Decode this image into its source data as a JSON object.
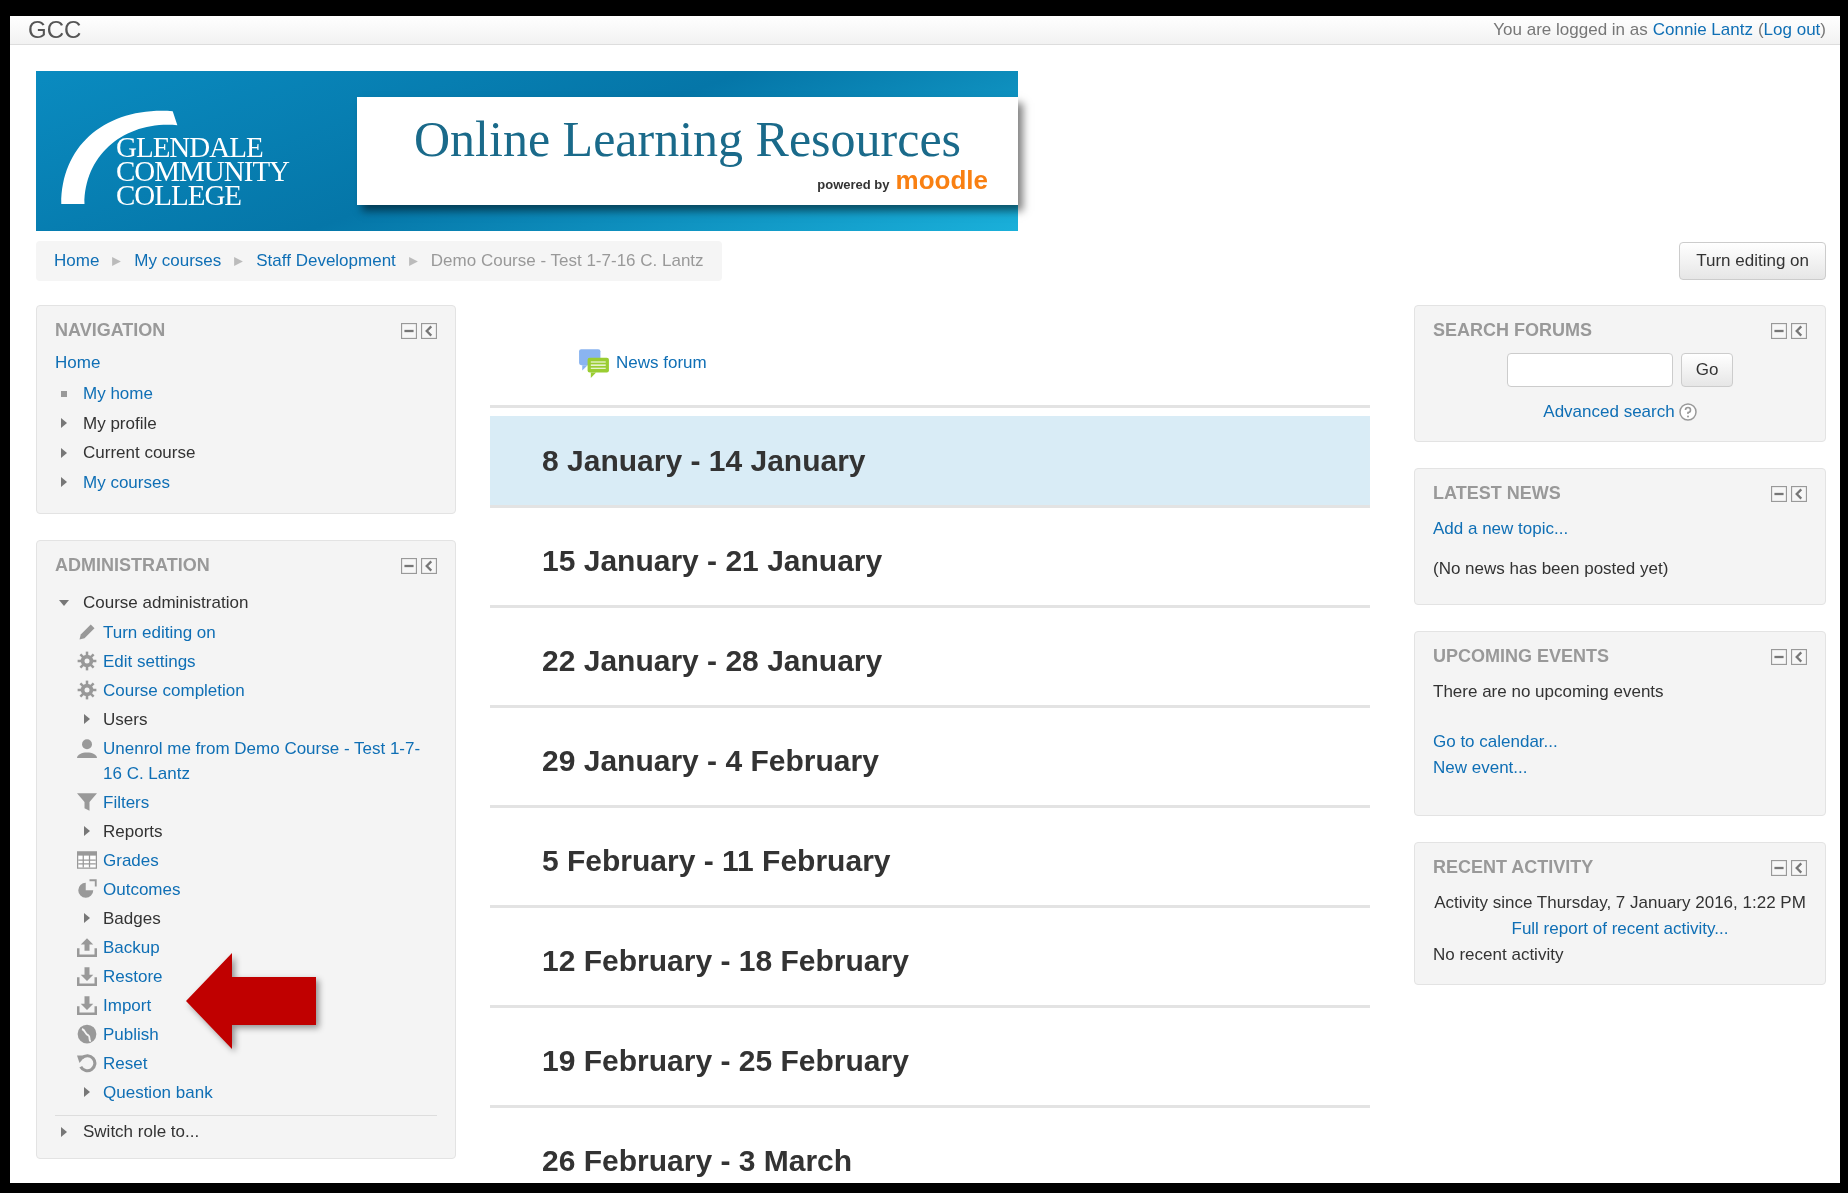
{
  "header": {
    "site_name": "GCC",
    "login_prefix": "You are logged in as",
    "user": "Connie Lantz",
    "paren_open": "(",
    "logout": "Log out",
    "paren_close": ")"
  },
  "banner": {
    "college_lines": [
      "GLENDALE",
      "COMMUNITY",
      "COLLEGE"
    ],
    "title": "Online Learning Resources",
    "powered_by": "powered by",
    "brand": "moodle"
  },
  "breadcrumb": [
    {
      "label": "Home",
      "current": false
    },
    {
      "label": "My courses",
      "current": false
    },
    {
      "label": "Staff Development",
      "current": false
    },
    {
      "label": "Demo Course - Test 1-7-16 C. Lantz",
      "current": true
    }
  ],
  "edit_button": "Turn editing on",
  "navigation": {
    "title": "NAVIGATION",
    "root": "Home",
    "items": [
      {
        "label": "My home",
        "kind": "bullet",
        "link": true
      },
      {
        "label": "My profile",
        "kind": "branch",
        "link": false
      },
      {
        "label": "Current course",
        "kind": "branch",
        "link": false
      },
      {
        "label": "My courses",
        "kind": "branch",
        "link": true
      }
    ]
  },
  "administration": {
    "title": "ADMINISTRATION",
    "section": {
      "label": "Course administration",
      "expanded": true,
      "children": [
        {
          "label": "Turn editing on",
          "kind": "pencil",
          "link": true
        },
        {
          "label": "Edit settings",
          "kind": "gear",
          "link": true
        },
        {
          "label": "Course completion",
          "kind": "gear",
          "link": true
        },
        {
          "label": "Users",
          "kind": "branch",
          "link": false
        },
        {
          "label": "Unenrol me from Demo Course - Test 1-7-16 C. Lantz",
          "kind": "user",
          "link": true
        },
        {
          "label": "Filters",
          "kind": "filter",
          "link": true
        },
        {
          "label": "Reports",
          "kind": "branch",
          "link": false
        },
        {
          "label": "Grades",
          "kind": "table",
          "link": true
        },
        {
          "label": "Outcomes",
          "kind": "outcome",
          "link": true
        },
        {
          "label": "Badges",
          "kind": "branch",
          "link": false
        },
        {
          "label": "Backup",
          "kind": "upload",
          "link": true
        },
        {
          "label": "Restore",
          "kind": "download",
          "link": true
        },
        {
          "label": "Import",
          "kind": "download",
          "link": true
        },
        {
          "label": "Publish",
          "kind": "globe",
          "link": true
        },
        {
          "label": "Reset",
          "kind": "reset",
          "link": true
        },
        {
          "label": "Question bank",
          "kind": "branch",
          "link": true
        }
      ]
    },
    "after": {
      "label": "Switch role to...",
      "expanded": false
    }
  },
  "news_forum": "News forum",
  "weeks": [
    {
      "title": "8 January - 14 January",
      "current": true
    },
    {
      "title": "15 January - 21 January",
      "current": false
    },
    {
      "title": "22 January - 28 January",
      "current": false
    },
    {
      "title": "29 January - 4 February",
      "current": false
    },
    {
      "title": "5 February - 11 February",
      "current": false
    },
    {
      "title": "12 February - 18 February",
      "current": false
    },
    {
      "title": "19 February - 25 February",
      "current": false
    },
    {
      "title": "26 February - 3 March",
      "current": false
    }
  ],
  "search_forums": {
    "title": "SEARCH FORUMS",
    "button": "Go",
    "advanced": "Advanced search"
  },
  "latest_news": {
    "title": "LATEST NEWS",
    "link": "Add a new topic...",
    "text": "(No news has been posted yet)"
  },
  "upcoming_events": {
    "title": "UPCOMING EVENTS",
    "text": "There are no upcoming events",
    "links": [
      "Go to calendar...",
      "New event..."
    ]
  },
  "recent_activity": {
    "title": "RECENT ACTIVITY",
    "since": "Activity since Thursday, 7 January 2016, 1:22 PM",
    "link": "Full report of recent activity...",
    "text": "No recent activity"
  }
}
